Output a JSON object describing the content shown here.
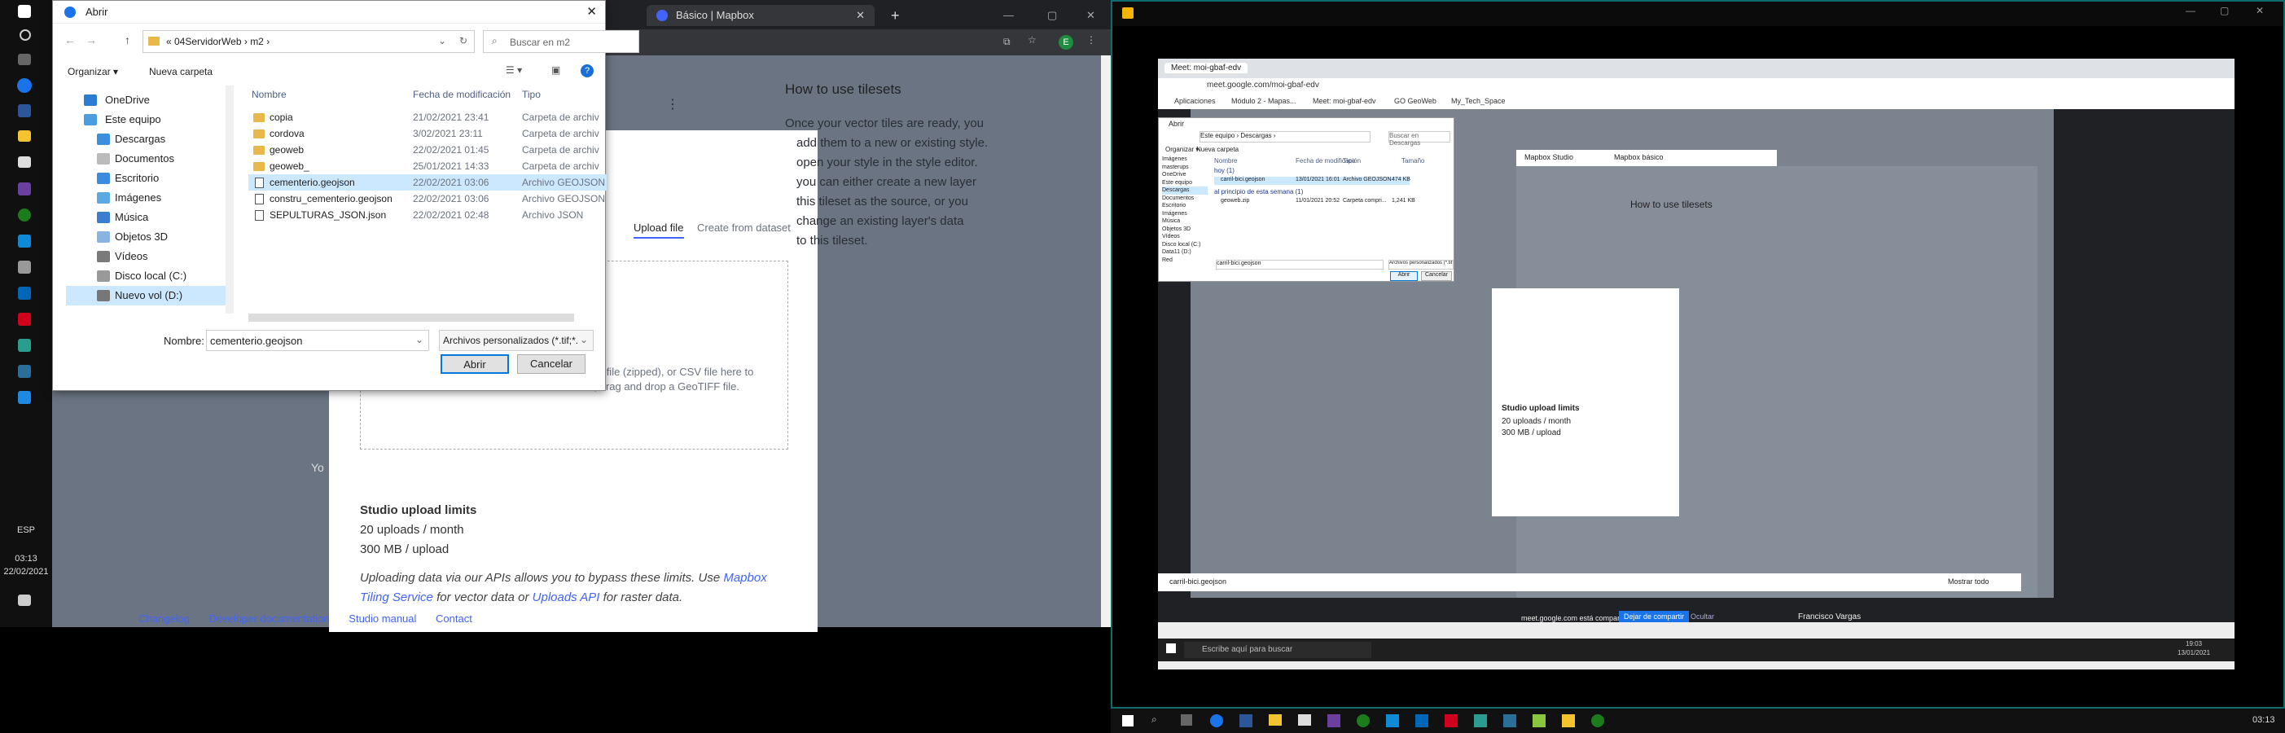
{
  "left_taskbar": {
    "time": "03:13",
    "date": "22/02/2021",
    "lang": "ESP"
  },
  "browser_tabs": [
    {
      "label": "Básico | Mapbox"
    }
  ],
  "mapbox": {
    "how_title": "How to use tilesets",
    "how_text_1": "Once your vector tiles are ready, you",
    "how_text_2": "add them to a new or existing style.",
    "how_text_3": "open your style in the style editor.",
    "how_text_4": "you can either create a new layer",
    "how_text_5": "this tileset as the source, or you",
    "how_text_6": "change an existing layer's data",
    "how_text_7": "to this tileset.",
    "tab_upload": "Upload file",
    "tab_dataset": "Create from dataset",
    "drop_text_1": "apefile (zipped), or CSV file here to",
    "drop_text_2": "s, drag and drop a GeoTIFF file.",
    "limits_title": "Studio upload limits",
    "limits_1": "20 uploads / month",
    "limits_2": "300 MB / upload",
    "api_1": "Uploading data via our APIs allows you to bypass these limits. Use ",
    "api_link1": "Mapbox",
    "api_link1b": "Tiling Service",
    "api_2": " for vector data or ",
    "api_link2": "Uploads API",
    "api_3": " for raster data.",
    "footer": [
      "Changelog",
      "Developer documentation",
      "Studio manual",
      "Contact"
    ],
    "you": "Yo"
  },
  "dialog": {
    "title": "Abrir",
    "path": [
      "«  04ServidorWeb",
      "›",
      "m2",
      "›"
    ],
    "search_placeholder": "Buscar en m2",
    "organize": "Organizar ▾",
    "new_folder": "Nueva carpeta",
    "tree": [
      "OneDrive",
      "Este equipo",
      "Descargas",
      "Documentos",
      "Escritorio",
      "Imágenes",
      "Música",
      "Objetos 3D",
      "Vídeos",
      "Disco local (C:)",
      "Nuevo vol (D:)"
    ],
    "columns": [
      "Nombre",
      "Fecha de modificación",
      "Tipo"
    ],
    "files": [
      {
        "name": "copia",
        "date": "21/02/2021 23:41",
        "type": "Carpeta de archiv",
        "kind": "folder"
      },
      {
        "name": "cordova",
        "date": "3/02/2021 23:11",
        "type": "Carpeta de archiv",
        "kind": "folder"
      },
      {
        "name": "geoweb",
        "date": "22/02/2021 01:45",
        "type": "Carpeta de archiv",
        "kind": "folder"
      },
      {
        "name": "geoweb_",
        "date": "25/01/2021 14:33",
        "type": "Carpeta de archiv",
        "kind": "folder"
      },
      {
        "name": "cementerio.geojson",
        "date": "22/02/2021 03:06",
        "type": "Archivo GEOJSON",
        "kind": "file"
      },
      {
        "name": "constru_cementerio.geojson",
        "date": "22/02/2021 03:06",
        "type": "Archivo GEOJSON",
        "kind": "file"
      },
      {
        "name": "SEPULTURAS_JSON.json",
        "date": "22/02/2021 02:48",
        "type": "Archivo JSON",
        "kind": "file"
      }
    ],
    "name_label": "Nombre:",
    "name_value": "cementerio.geojson",
    "filter": "Archivos personalizados (*.tif;*.",
    "open": "Abrir",
    "cancel": "Cancelar"
  },
  "share": {
    "url": "meet.google.com/moi-gbaf-edv",
    "inner_dialog_title": "Abrir",
    "inner_path": [
      "Este equipo",
      "›",
      "Descargas",
      "›"
    ],
    "inner_search": "Buscar en Descargas",
    "inner_organize": "Organizar ▾",
    "inner_new_folder": "Nueva carpeta",
    "inner_cols": [
      "Nombre",
      "Fecha de modificación",
      "Tipo",
      "Tamaño"
    ],
    "inner_group1": "hoy (1)",
    "inner_file1": {
      "name": "carril-bici.geojson",
      "date": "13/01/2021 16:01",
      "type": "Archivo GEOJSON",
      "size": "474 KB"
    },
    "inner_group2": "al principio de esta semana (1)",
    "inner_file2": {
      "name": "geoweb.zip",
      "date": "11/01/2021 20:52",
      "type": "Carpeta compri...",
      "size": "1,241 KB"
    },
    "inner_name_value": "carril-bici.geojson",
    "inner_filter": "Archivos personalizados (*.tif;*.",
    "inner_open": "Abrir",
    "inner_cancel": "Cancelar",
    "inner_tree": [
      "Imágenes",
      "masterups",
      "OneDrive",
      "Este equipo",
      "Descargas",
      "Documentos",
      "Escritorio",
      "Imágenes",
      "Música",
      "Objetos 3D",
      "Vídeos",
      "Disco local (C:)",
      "Data11 (D:)",
      "Red"
    ],
    "inner_how": "How to use tilesets",
    "inner_limits_title": "Studio upload limits",
    "inner_limits_1": "20 uploads / month",
    "inner_limits_2": "300 MB / upload",
    "share_notice": "meet.google.com está compartiendo tu pantalla.",
    "stop_share": "Dejar de compartir",
    "hide": "Ocultar",
    "presenter": "Francisco Vargas",
    "download": "carril-bici.geojson",
    "show_all": "Mostrar todo",
    "search_taskbar": "Escribe aquí para buscar",
    "inner_time": "19:03",
    "inner_date": "13/01/2021",
    "tabs": [
      "Meet: moi-gbaf-edv",
      "Mapbox Studio",
      "Mapbox básico"
    ],
    "bookmarks": [
      "Aplicaciones",
      "Módulo 2 - Mapas...",
      "Meet: moi-gbaf-edv",
      "GO GeoWeb",
      "My_Tech_Space"
    ]
  },
  "right_taskbar": {
    "time": "03:13"
  }
}
